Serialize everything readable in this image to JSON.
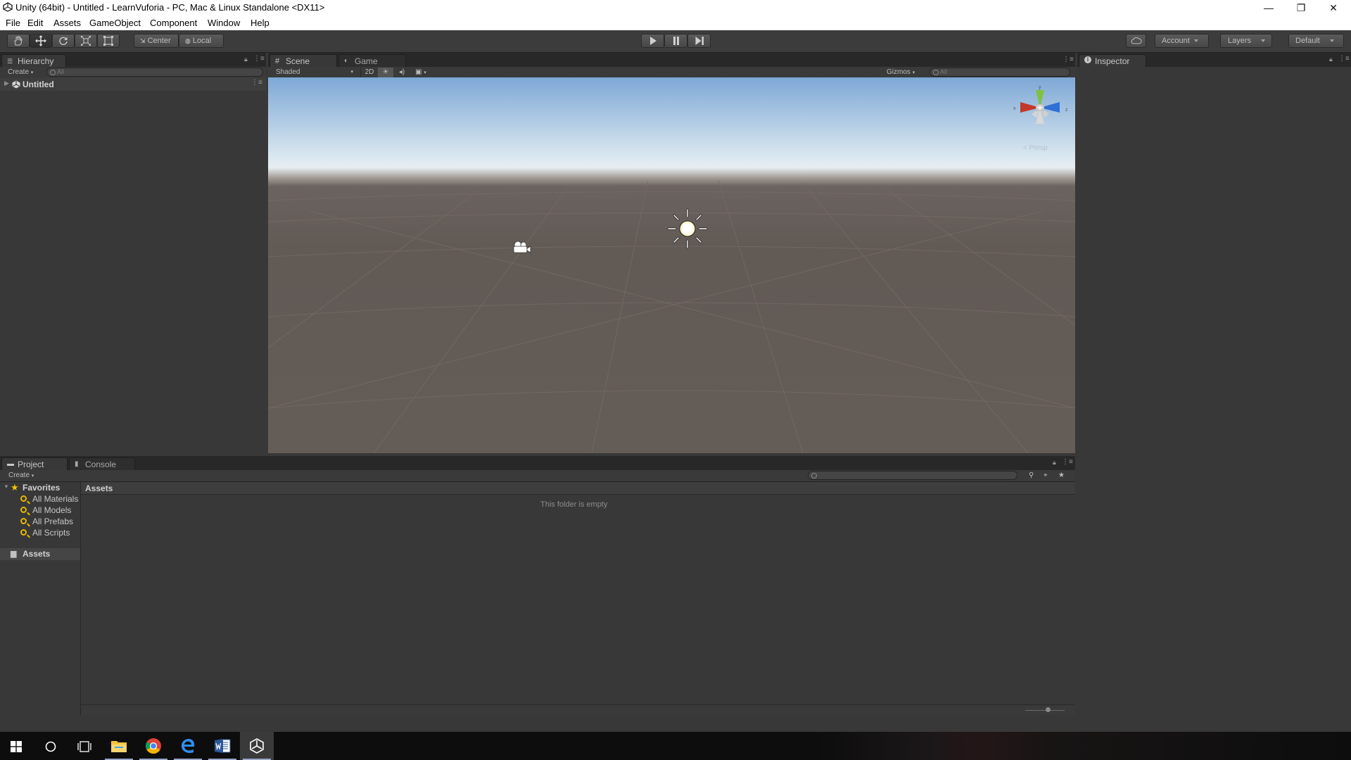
{
  "window": {
    "title": "Unity (64bit) - Untitled - LearnVuforia - PC, Mac & Linux Standalone <DX11>",
    "controls": {
      "minimize": "—",
      "restore": "❐",
      "close": "✕"
    }
  },
  "menu": [
    "File",
    "Edit",
    "Assets",
    "GameObject",
    "Component",
    "Window",
    "Help"
  ],
  "toolbar": {
    "tools": [
      {
        "name": "hand-tool",
        "icon": "hand-icon",
        "active": false
      },
      {
        "name": "move-tool",
        "icon": "move-icon",
        "active": true
      },
      {
        "name": "rotate-tool",
        "icon": "rotate-icon",
        "active": false
      },
      {
        "name": "scale-tool",
        "icon": "scale-icon",
        "active": false
      },
      {
        "name": "rect-tool",
        "icon": "rect-icon",
        "active": false
      }
    ],
    "pivot": "Center",
    "space": "Local",
    "play_icons": [
      "play-icon",
      "pause-icon",
      "step-icon"
    ],
    "account": "Account",
    "layers": "Layers",
    "layout": "Default"
  },
  "hierarchy": {
    "tab": "Hierarchy",
    "create": "Create",
    "search": "All",
    "scene_name": "Untitled"
  },
  "scene_view": {
    "tabs": [
      "Scene",
      "Game"
    ],
    "draw_mode": "Shaded",
    "mode_2d": "2D",
    "gizmos": "Gizmos",
    "search": "All",
    "gizmo_axes": {
      "y": "y",
      "x": "x",
      "z": "z"
    },
    "projection": "< Persp",
    "colors": {
      "sky_top": "#7ea8d6",
      "horizon": "#e7eef2",
      "ground": "#645c57",
      "axis_x": "#c0392b",
      "axis_y": "#7fc241",
      "axis_z": "#2f6fd6"
    }
  },
  "inspector": {
    "tab": "Inspector"
  },
  "project": {
    "tabs": [
      "Project",
      "Console"
    ],
    "create": "Create",
    "favorites_label": "Favorites",
    "favorites": [
      "All Materials",
      "All Models",
      "All Prefabs",
      "All Scripts"
    ],
    "assets_root": "Assets",
    "breadcrumb": "Assets",
    "empty_message": "This folder is empty"
  },
  "taskbar": {
    "items": [
      "windows-start-icon",
      "cortana-search-icon",
      "task-view-icon",
      "file-explorer-icon",
      "chrome-icon",
      "edge-icon",
      "word-icon",
      "unity-icon"
    ]
  }
}
